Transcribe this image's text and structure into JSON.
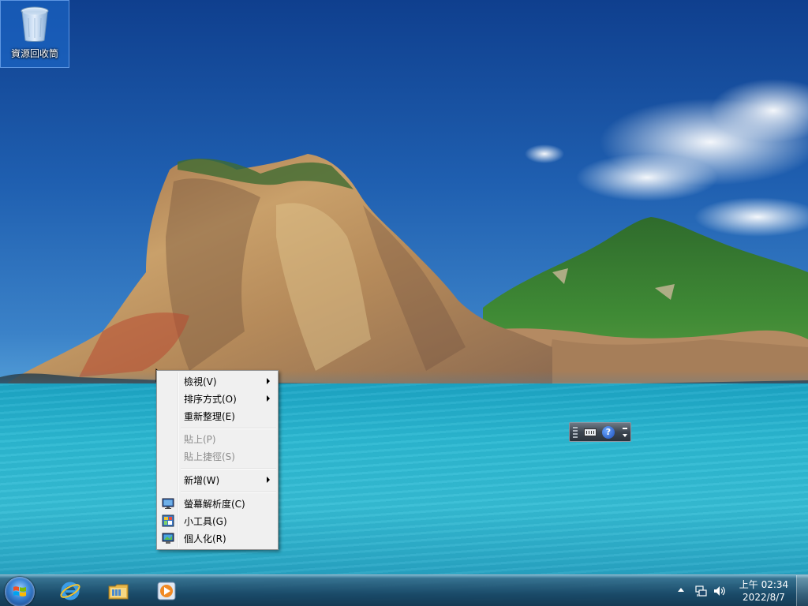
{
  "desktop": {
    "icons": [
      {
        "label": "資源回收筒",
        "icon": "recycle-bin-icon"
      }
    ]
  },
  "context_menu": {
    "items": [
      {
        "label": "檢視(V)",
        "submenu": true,
        "enabled": true
      },
      {
        "label": "排序方式(O)",
        "submenu": true,
        "enabled": true
      },
      {
        "label": "重新整理(E)",
        "submenu": false,
        "enabled": true
      },
      {
        "label": "貼上(P)",
        "submenu": false,
        "enabled": false
      },
      {
        "label": "貼上捷徑(S)",
        "submenu": false,
        "enabled": false
      },
      {
        "label": "新增(W)",
        "submenu": true,
        "enabled": true
      },
      {
        "label": "螢幕解析度(C)",
        "submenu": false,
        "enabled": true,
        "icon": "screen-resolution-icon"
      },
      {
        "label": "小工具(G)",
        "submenu": false,
        "enabled": true,
        "icon": "gadgets-icon"
      },
      {
        "label": "個人化(R)",
        "submenu": false,
        "enabled": true,
        "icon": "personalize-icon"
      }
    ]
  },
  "language_bar": {
    "help_glyph": "?",
    "icons": [
      "keyboard-icon",
      "help-icon",
      "options-icon"
    ]
  },
  "taskbar": {
    "pinned": [
      {
        "name": "Internet Explorer",
        "icon": "internet-explorer-icon"
      },
      {
        "name": "Windows Explorer",
        "icon": "folder-icon"
      },
      {
        "name": "Windows Media Player",
        "icon": "media-player-icon"
      }
    ],
    "clock": {
      "time": "上午 02:34",
      "date": "2022/8/7"
    }
  }
}
